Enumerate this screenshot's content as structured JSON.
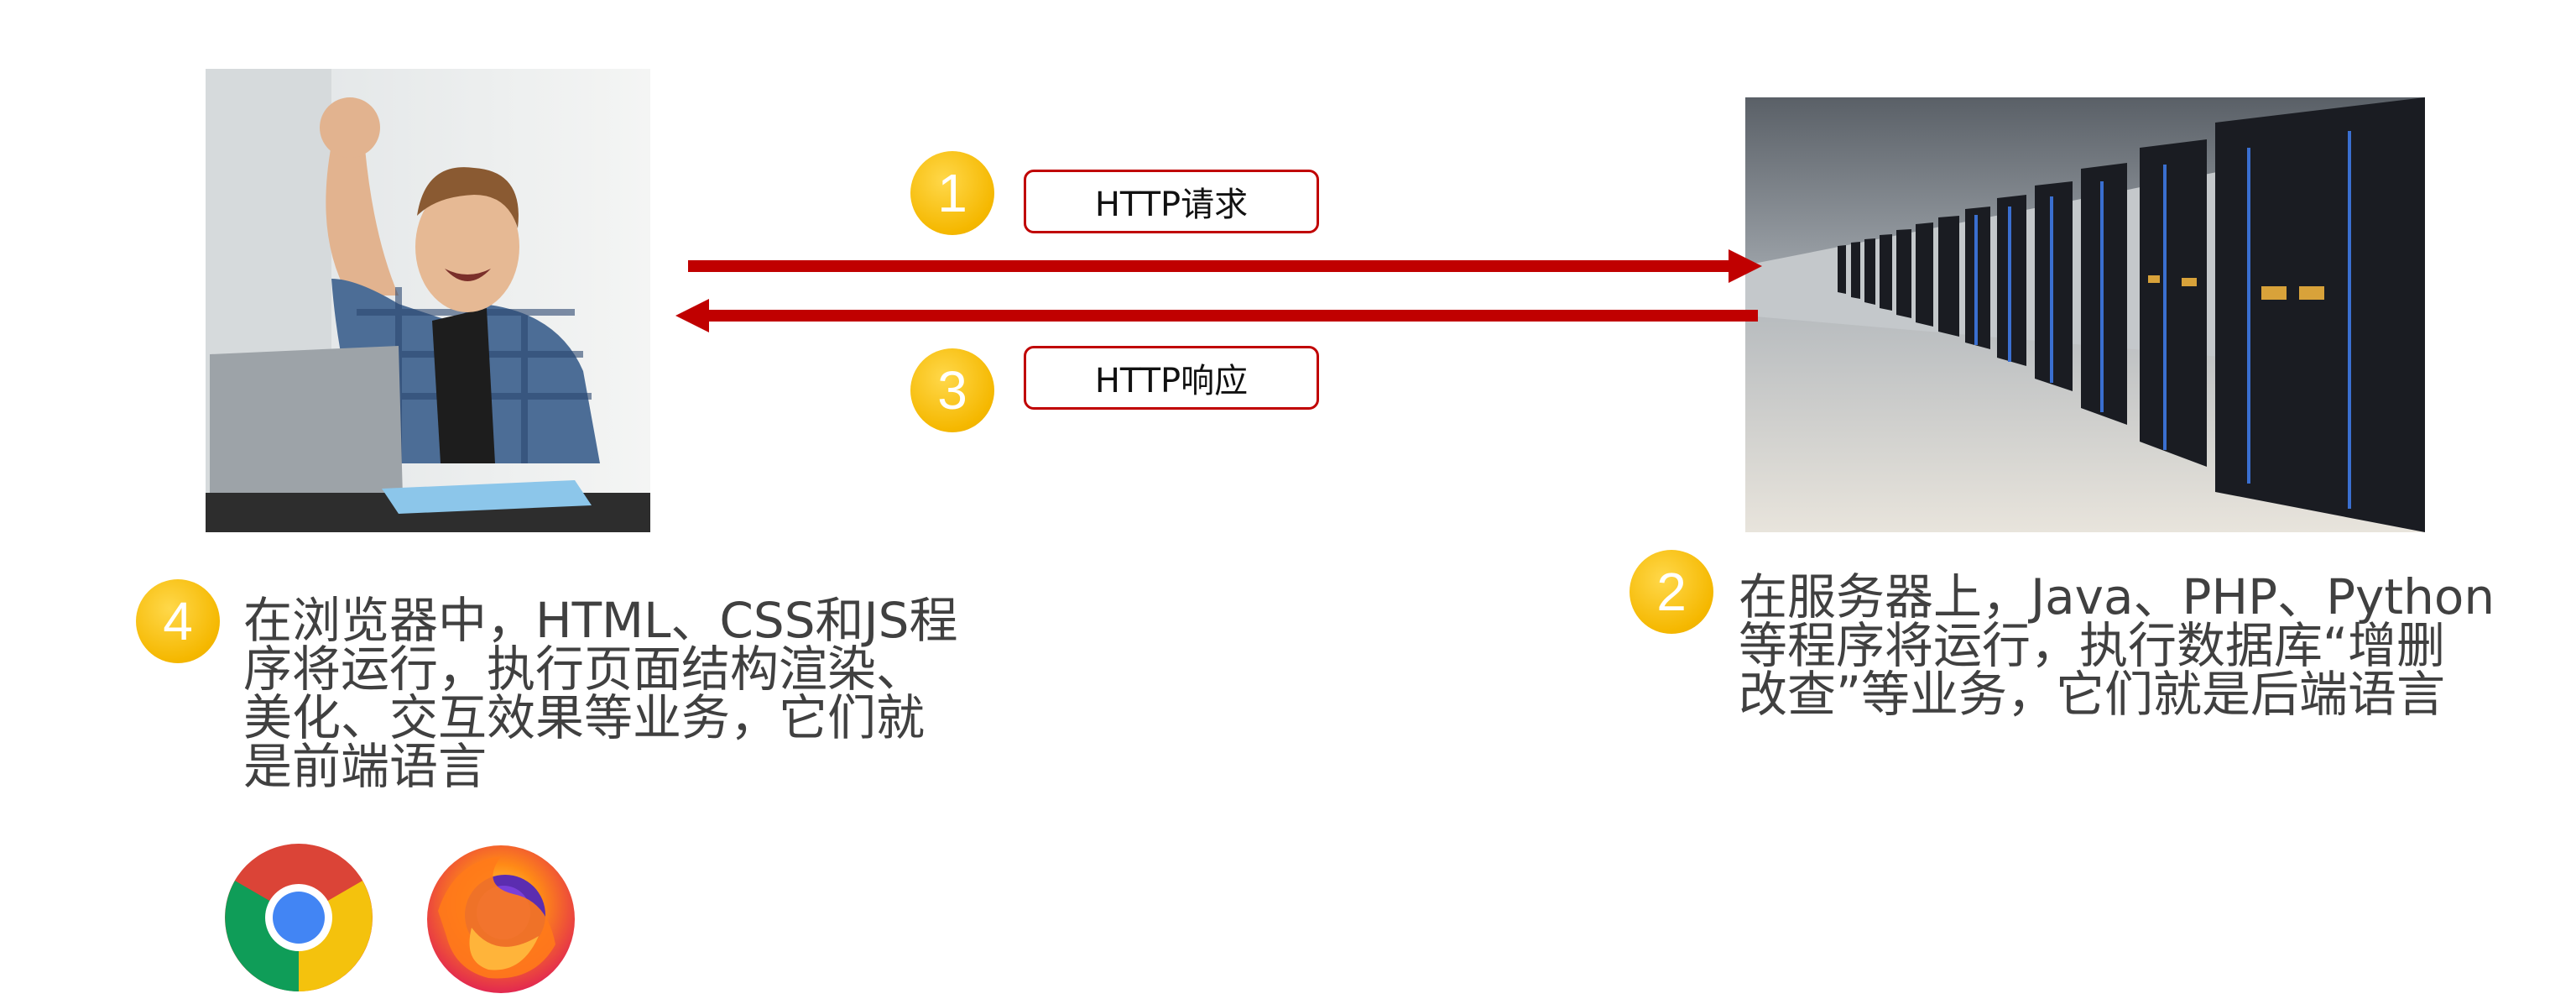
{
  "request": {
    "step": "1",
    "label": "HTTP请求"
  },
  "response": {
    "step": "3",
    "label": "HTTP响应"
  },
  "frontend": {
    "step": "4",
    "description": "在浏览器中，HTML、CSS和JS程\n序将运行，执行页面结构渲染、\n美化、交互效果等业务，它们就\n是前端语言"
  },
  "backend": {
    "step": "2",
    "description": "在服务器上，Java、PHP、Python\n等程序将运行，执行数据库“增删\n改查”等业务，它们就是后端语言"
  },
  "colors": {
    "arrow": "#c00000",
    "badge": "#f5b800",
    "text": "#404040"
  },
  "icons": [
    "user-with-laptop-photo",
    "data-center-photo",
    "chrome-icon",
    "firefox-icon"
  ]
}
